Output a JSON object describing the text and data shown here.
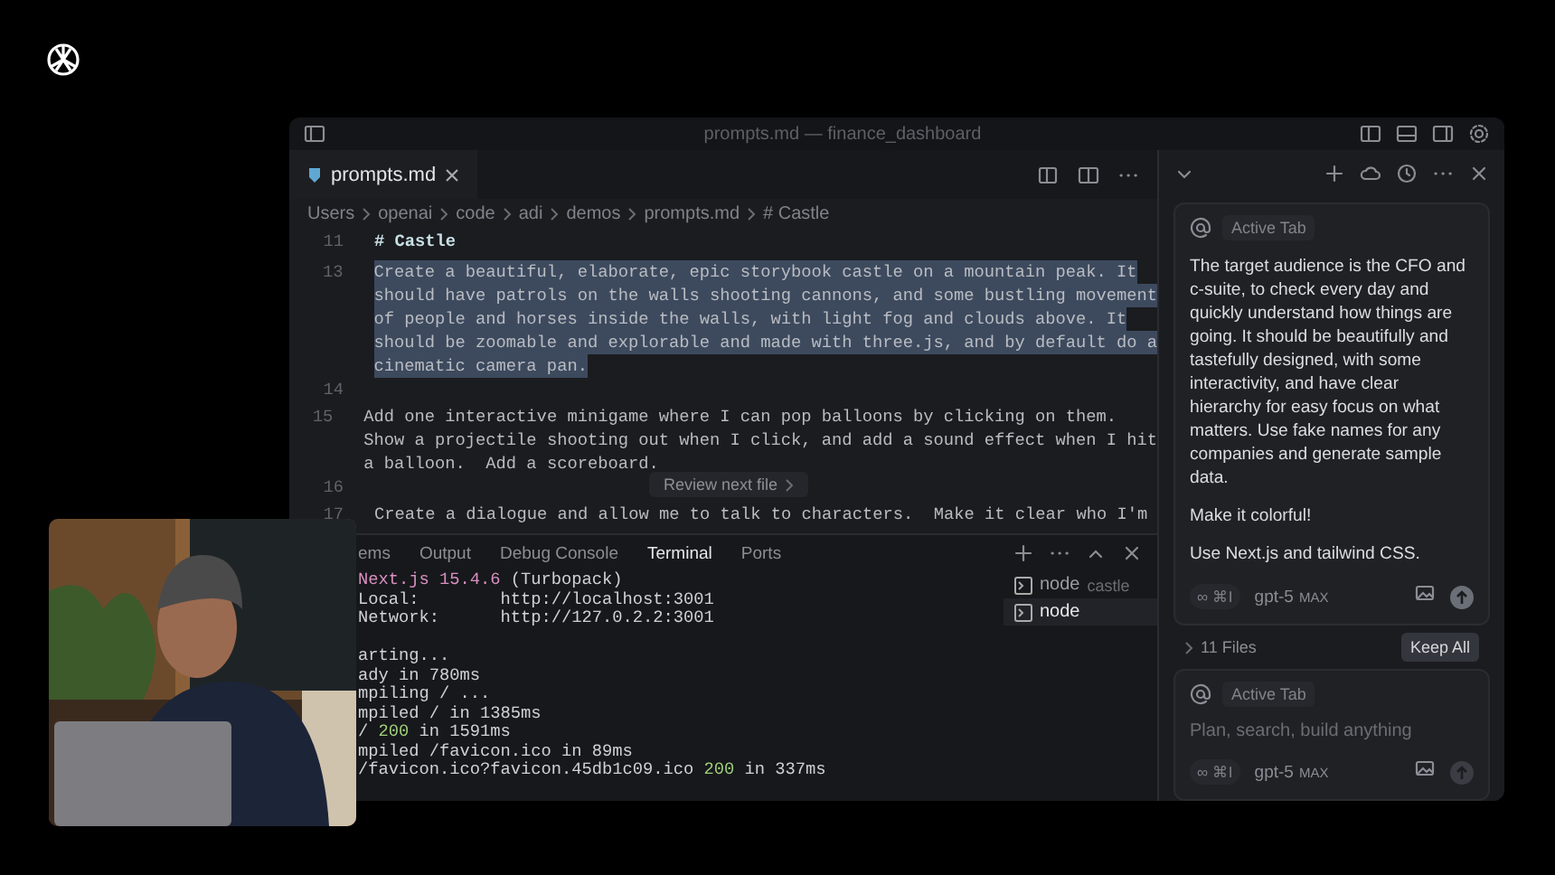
{
  "window": {
    "title": "prompts.md — finance_dashboard"
  },
  "editor": {
    "tabs": [
      {
        "label": "prompts.md",
        "selected": true
      }
    ],
    "breadcrumb": [
      "Users",
      "openai",
      "code",
      "adi",
      "demos",
      "prompts.md",
      "# Castle"
    ],
    "lines": [
      {
        "number": "11",
        "kind": "heading",
        "rows": [
          "# Castle"
        ],
        "selected": false
      },
      {
        "number": "13",
        "kind": "text",
        "rows": [
          "Create a beautiful, elaborate, epic storybook castle on a mountain peak. It",
          "should have patrols on the walls shooting cannons, and some bustling movement",
          "of people and horses inside the walls, with light fog and clouds above. It",
          "should be zoomable and explorable and made with three.js, and by default do a",
          "cinematic camera pan."
        ],
        "selected": true
      },
      {
        "number": "14",
        "kind": "blank"
      },
      {
        "number": "15",
        "kind": "text",
        "rows": [
          "Add one interactive minigame where I can pop balloons by clicking on them.",
          "Show a projectile shooting out when I click, and add a sound effect when I hit",
          "a balloon.  Add a scoreboard."
        ],
        "selected": false
      },
      {
        "number": "16",
        "kind": "blank"
      },
      {
        "number": "17",
        "kind": "text",
        "rows": [
          "Create a dialogue and allow me to talk to characters.  Make it clear who I'm"
        ],
        "selected": false
      }
    ],
    "tooltip": "Review next file"
  },
  "panel": {
    "tabs": [
      {
        "label": "ems",
        "selected": false
      },
      {
        "label": "Output",
        "selected": false
      },
      {
        "label": "Debug Console",
        "selected": false
      },
      {
        "label": "Terminal",
        "selected": true
      },
      {
        "label": "Ports",
        "selected": false
      }
    ],
    "terminal": [
      [
        {
          "text": "Next.js 15.4.6",
          "kind": "accent"
        },
        {
          "text": " (Turbopack)",
          "kind": "plain"
        }
      ],
      [
        {
          "text": "Local:        http://localhost:3001",
          "kind": "plain"
        }
      ],
      [
        {
          "text": "Network:      http://127.0.2.2:3001",
          "kind": "plain"
        }
      ],
      [
        {
          "text": "arting...",
          "kind": "gap-before"
        }
      ],
      [
        {
          "text": "ady in 780ms",
          "kind": "plain"
        }
      ],
      [
        {
          "text": "mpiling / ...",
          "kind": "plain"
        }
      ],
      [
        {
          "text": "mpiled / in 1385ms",
          "kind": "plain"
        }
      ],
      [
        {
          "text": "/ ",
          "kind": "plain"
        },
        {
          "text": "200",
          "kind": "ok"
        },
        {
          "text": " in 1591ms",
          "kind": "plain"
        }
      ],
      [
        {
          "text": "mpiled /favicon.ico in 89ms",
          "kind": "plain"
        }
      ],
      [
        {
          "text": "/favicon.ico?favicon.45db1c09.ico ",
          "kind": "plain"
        },
        {
          "text": "200",
          "kind": "ok"
        },
        {
          "text": " in 337ms",
          "kind": "plain"
        }
      ]
    ],
    "sessions": [
      {
        "name": "node",
        "detail": "castle",
        "selected": false
      },
      {
        "name": "node",
        "selected": true
      }
    ]
  },
  "chat": {
    "context_chip": "Active Tab",
    "message": [
      "The target audience is the CFO and c-suite, to check every day and quickly understand how things are going. It should be beautifully and tastefully designed, with some interactivity, and have clear hierarchy for easy focus on what matters.  Use fake names for any companies and generate sample data.",
      "Make it colorful!",
      "Use Next.js and tailwind CSS."
    ],
    "mode": "∞ ⌘I",
    "model": "gpt-5",
    "model_tag": "MAX",
    "files": "11 Files",
    "keep_button": "Keep All",
    "input": {
      "context_chip": "Active Tab",
      "placeholder": "Plan, search, build anything",
      "mode": "∞ ⌘I",
      "model": "gpt-5",
      "model_tag": "MAX"
    }
  }
}
